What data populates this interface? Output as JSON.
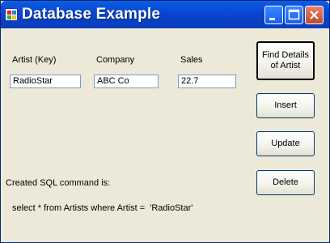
{
  "window": {
    "title": "Database Example"
  },
  "fields": {
    "artist_label": "Artist  (Key)",
    "company_label": "Company",
    "sales_label": "Sales",
    "artist_value": "RadioStar",
    "company_value": "ABC Co",
    "sales_value": "22.7"
  },
  "buttons": {
    "find": "Find Details of Artist",
    "insert": "Insert",
    "update": "Update",
    "delete": "Delete"
  },
  "sql": {
    "caption": "Created SQL command is:",
    "command": "select * from Artists where Artist =  'RadioStar'"
  }
}
